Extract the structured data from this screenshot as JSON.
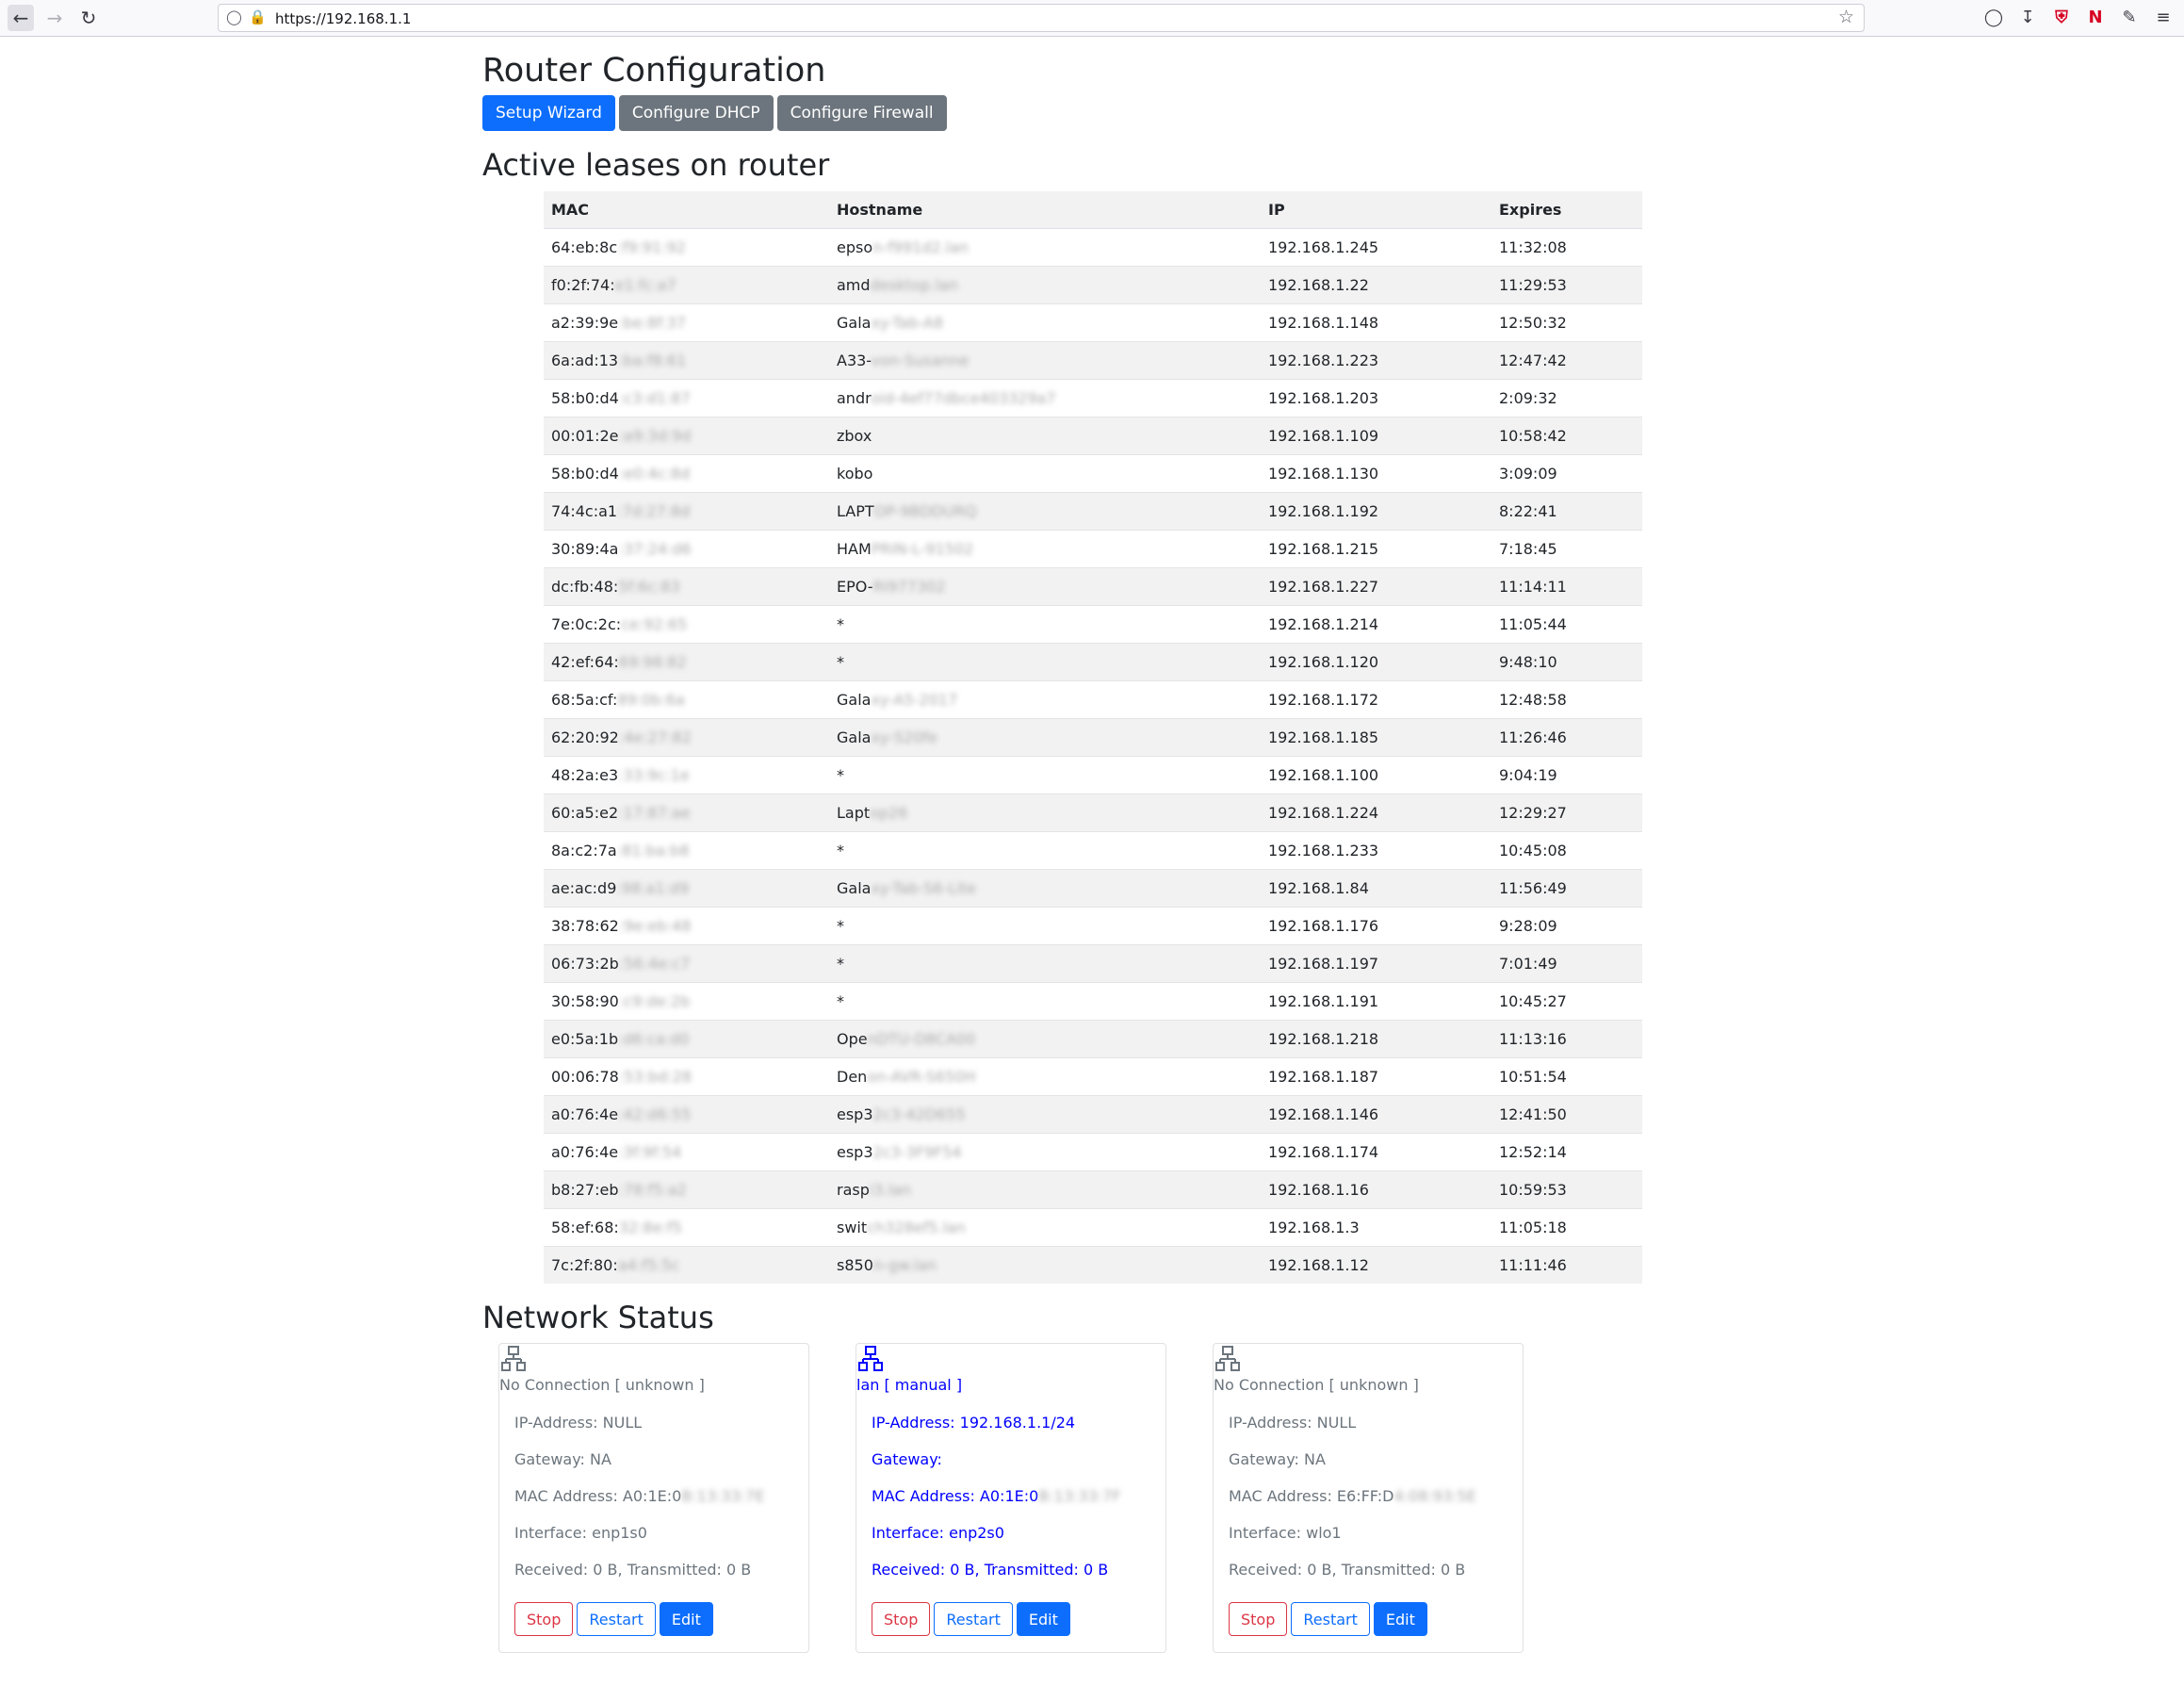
{
  "browser": {
    "url": "https://192.168.1.1"
  },
  "page": {
    "title": "Router Configuration",
    "buttons": {
      "setup_wizard": "Setup Wizard",
      "configure_dhcp": "Configure DHCP",
      "configure_firewall": "Configure Firewall"
    },
    "leases_heading": "Active leases on router",
    "status_heading": "Network Status"
  },
  "leases": {
    "columns": [
      "MAC",
      "Hostname",
      "IP",
      "Expires"
    ],
    "rows": [
      {
        "mac": "64:eb:8c",
        "mac_blur": ":f9:91:92",
        "host": "epso",
        "host_blur": "n-f991d2.lan",
        "ip": "192.168.1.245",
        "expires": "11:32:08"
      },
      {
        "mac": "f0:2f:74:",
        "mac_blur": "e1:fc:a7",
        "host": "amd",
        "host_blur": "desktop.lan",
        "ip": "192.168.1.22",
        "expires": "11:29:53"
      },
      {
        "mac": "a2:39:9e",
        "mac_blur": ":be:8f:37",
        "host": "Gala",
        "host_blur": "xy-Tab-A8",
        "ip": "192.168.1.148",
        "expires": "12:50:32"
      },
      {
        "mac": "6a:ad:13",
        "mac_blur": ":ba:f8:61",
        "host": "A33-",
        "host_blur": "von-Susanne",
        "ip": "192.168.1.223",
        "expires": "12:47:42"
      },
      {
        "mac": "58:b0:d4",
        "mac_blur": ":c3:d1:87",
        "host": "andr",
        "host_blur": "oid-4ef77dbce403329a7",
        "ip": "192.168.1.203",
        "expires": "2:09:32"
      },
      {
        "mac": "00:01:2e",
        "mac_blur": ":a9:3d:9d",
        "host": "zbox",
        "host_blur": "",
        "ip": "192.168.1.109",
        "expires": "10:58:42"
      },
      {
        "mac": "58:b0:d4",
        "mac_blur": ":e0:4c:8d",
        "host": "kobo",
        "host_blur": "",
        "ip": "192.168.1.130",
        "expires": "3:09:09"
      },
      {
        "mac": "74:4c:a1",
        "mac_blur": ":7d:27:8d",
        "host": "LAPT",
        "host_blur": "OP-9BDDURQ",
        "ip": "192.168.1.192",
        "expires": "8:22:41"
      },
      {
        "mac": "30:89:4a",
        "mac_blur": ":37:24:d6",
        "host": "HAM",
        "host_blur": "PRIN-L-91502",
        "ip": "192.168.1.215",
        "expires": "7:18:45"
      },
      {
        "mac": "dc:fb:48:",
        "mac_blur": "5f:6c:83",
        "host": "EPO-",
        "host_blur": "RI977302",
        "ip": "192.168.1.227",
        "expires": "11:14:11"
      },
      {
        "mac": "7e:0c:2c:",
        "mac_blur": "ce:92:65",
        "host": "*",
        "host_blur": "",
        "ip": "192.168.1.214",
        "expires": "11:05:44"
      },
      {
        "mac": "42:ef:64:",
        "mac_blur": "69:98:82",
        "host": "*",
        "host_blur": "",
        "ip": "192.168.1.120",
        "expires": "9:48:10"
      },
      {
        "mac": "68:5a:cf:",
        "mac_blur": "89:0b:6a",
        "host": "Gala",
        "host_blur": "xy-A5-2017",
        "ip": "192.168.1.172",
        "expires": "12:48:58"
      },
      {
        "mac": "62:20:92",
        "mac_blur": ":4e:27:82",
        "host": "Gala",
        "host_blur": "xy-S20fe",
        "ip": "192.168.1.185",
        "expires": "11:26:46"
      },
      {
        "mac": "48:2a:e3",
        "mac_blur": ":33:9c:1e",
        "host": "*",
        "host_blur": "",
        "ip": "192.168.1.100",
        "expires": "9:04:19"
      },
      {
        "mac": "60:a5:e2",
        "mac_blur": ":17:87:ae",
        "host": "Lapt",
        "host_blur": "op26",
        "ip": "192.168.1.224",
        "expires": "12:29:27"
      },
      {
        "mac": "8a:c2:7a",
        "mac_blur": ":81:ba:b8",
        "host": "*",
        "host_blur": "",
        "ip": "192.168.1.233",
        "expires": "10:45:08"
      },
      {
        "mac": "ae:ac:d9",
        "mac_blur": ":98:a1:d9",
        "host": "Gala",
        "host_blur": "xy-Tab-S6-Lite",
        "ip": "192.168.1.84",
        "expires": "11:56:49"
      },
      {
        "mac": "38:78:62",
        "mac_blur": ":9e:eb:48",
        "host": "*",
        "host_blur": "",
        "ip": "192.168.1.176",
        "expires": "9:28:09"
      },
      {
        "mac": "06:73:2b",
        "mac_blur": ":56:4e:c7",
        "host": "*",
        "host_blur": "",
        "ip": "192.168.1.197",
        "expires": "7:01:49"
      },
      {
        "mac": "30:58:90",
        "mac_blur": ":c9:de:2b",
        "host": "*",
        "host_blur": "",
        "ip": "192.168.1.191",
        "expires": "10:45:27"
      },
      {
        "mac": "e0:5a:1b",
        "mac_blur": ":d6:ca:d0",
        "host": "Ope",
        "host_blur": "nDTU-D8CA00",
        "ip": "192.168.1.218",
        "expires": "11:13:16"
      },
      {
        "mac": "00:06:78",
        "mac_blur": ":53:bd:28",
        "host": "Den",
        "host_blur": "on-AVR-S650H",
        "ip": "192.168.1.187",
        "expires": "10:51:54"
      },
      {
        "mac": "a0:76:4e",
        "mac_blur": ":42:d6:55",
        "host": "esp3",
        "host_blur": "2c3-42D655",
        "ip": "192.168.1.146",
        "expires": "12:41:50"
      },
      {
        "mac": "a0:76:4e",
        "mac_blur": ":3f:9f:54",
        "host": "esp3",
        "host_blur": "2c3-3F9F54",
        "ip": "192.168.1.174",
        "expires": "12:52:14"
      },
      {
        "mac": "b8:27:eb",
        "mac_blur": ":78:f5:a2",
        "host": "rasp",
        "host_blur": "i3.lan",
        "ip": "192.168.1.16",
        "expires": "10:59:53"
      },
      {
        "mac": "58:ef:68:",
        "mac_blur": "32:8e:f5",
        "host": "swit",
        "host_blur": "ch328ef5.lan",
        "ip": "192.168.1.3",
        "expires": "11:05:18"
      },
      {
        "mac": "7c:2f:80:",
        "mac_blur": "a4:f5:5c",
        "host": "s850",
        "host_blur": "n-gw.lan",
        "ip": "192.168.1.12",
        "expires": "11:11:46"
      }
    ]
  },
  "network": {
    "cards": [
      {
        "connection": "No Connection [ unknown ]",
        "ip": "IP-Address: NULL",
        "gateway": "Gateway: NA",
        "mac": "MAC Address: A0:1E:0",
        "mac_blur": "B:13:33:7E",
        "interface": "Interface: enp1s0",
        "traffic": "Received: 0 B, Transmitted: 0 B",
        "active": false
      },
      {
        "connection": "lan [ manual ]",
        "ip": "IP-Address: 192.168.1.1/24",
        "gateway": "Gateway:",
        "mac": "MAC Address: A0:1E:0",
        "mac_blur": "B:13:33:7F",
        "interface": "Interface: enp2s0",
        "traffic": "Received: 0 B, Transmitted: 0 B",
        "active": true
      },
      {
        "connection": "No Connection [ unknown ]",
        "ip": "IP-Address: NULL",
        "gateway": "Gateway: NA",
        "mac": "MAC Address: E6:FF:D",
        "mac_blur": "4:08:93:5E",
        "interface": "Interface: wlo1",
        "traffic": "Received: 0 B, Transmitted: 0 B",
        "active": false
      }
    ],
    "actions": {
      "stop": "Stop",
      "restart": "Restart",
      "edit": "Edit"
    },
    "colors": {
      "active": "#0000ff",
      "inactive": "#6c757d"
    }
  },
  "colors": {
    "primary": "#0d6efd",
    "secondary": "#6c757d",
    "danger": "#dc3545"
  }
}
